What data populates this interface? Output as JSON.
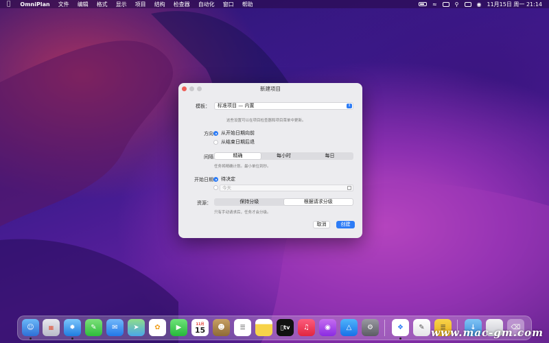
{
  "menubar": {
    "app_name": "OmniPlan",
    "items": [
      "文件",
      "编辑",
      "格式",
      "显示",
      "项目",
      "结构",
      "检查器",
      "自动化",
      "窗口",
      "帮助"
    ],
    "clock": "11月15日 周一  21:14"
  },
  "dialog": {
    "title": "新建项目",
    "template": {
      "label": "模板：",
      "value": "标准项目 — 内置",
      "hint": "这些设置可以在项目检查器和项目菜单中更新。"
    },
    "direction": {
      "label": "方向：",
      "options": [
        {
          "label": "从开始日期向前",
          "selected": true
        },
        {
          "label": "从结束日期后退",
          "selected": false
        }
      ]
    },
    "interval": {
      "label": "间隔：",
      "segments": [
        {
          "label": "精确",
          "selected": true
        },
        {
          "label": "每小时",
          "selected": false
        },
        {
          "label": "每日",
          "selected": false
        }
      ],
      "hint": "任务将精确计划。最小单位到秒。"
    },
    "start_date": {
      "label": "开始日期：",
      "options": [
        {
          "label": "待决定",
          "selected": true
        }
      ],
      "date_placeholder": "今天"
    },
    "resources": {
      "label": "资源：",
      "segments": [
        {
          "label": "保持分级",
          "selected": false
        },
        {
          "label": "根据请求分级",
          "selected": true
        }
      ],
      "hint": "只有手动请求后，任务才会分级。"
    },
    "cancel_label": "取消",
    "create_label": "创建"
  },
  "dock": {
    "calendar_month": "11月",
    "calendar_day": "15",
    "tv_label": "tv"
  },
  "watermark": "www.mac-gm.com",
  "colors": {
    "accent": "#2d7cf6"
  }
}
